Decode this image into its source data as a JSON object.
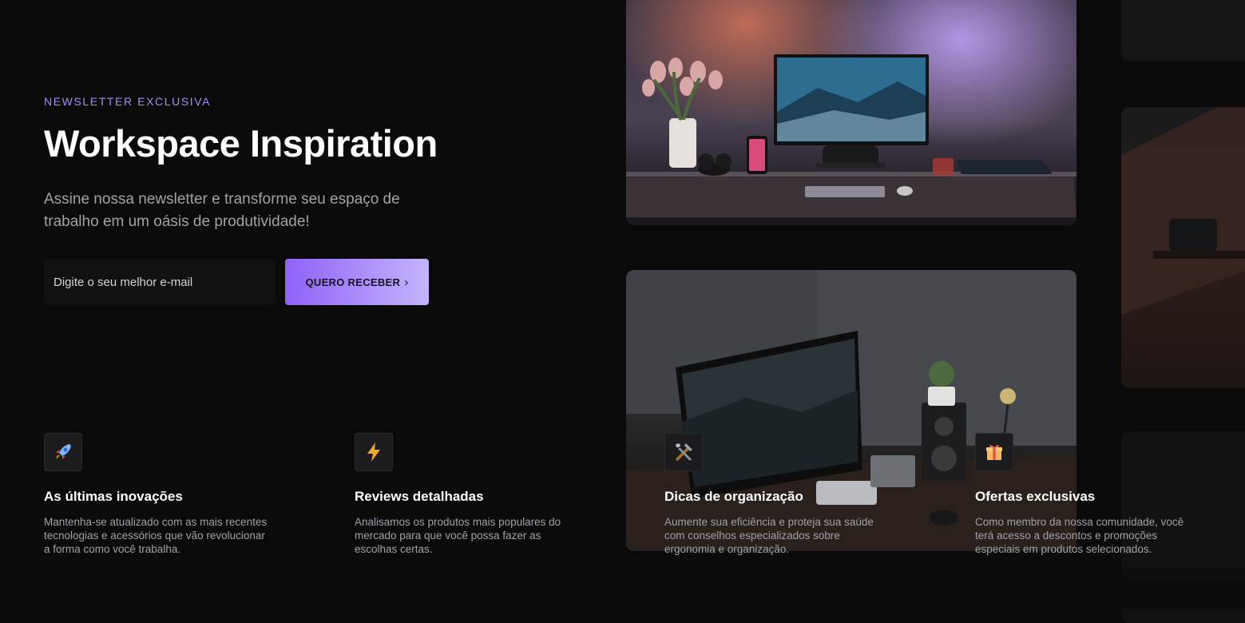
{
  "hero": {
    "eyebrow": "NEWSLETTER EXCLUSIVA",
    "title": "Workspace Inspiration",
    "subtitle": "Assine nossa newsletter e transforme seu espaço de trabalho em um oásis de produtividade!"
  },
  "form": {
    "email_placeholder": "Digite o seu melhor e-mail",
    "email_value": "",
    "cta_label": "QUERO RECEBER",
    "cta_icon": "chevron-right-icon",
    "cta_gradient": [
      "#9061f9",
      "#c4b5fd"
    ]
  },
  "colors": {
    "background": "#0a0a0b",
    "accent": "#a78bfa",
    "muted_text": "#a1a1aa"
  },
  "features": [
    {
      "icon": "rocket-icon",
      "title": "As últimas inovações",
      "description": "Mantenha-se atualizado com as mais recentes tecnologias e acessórios que vão revolucionar a forma como você trabalha."
    },
    {
      "icon": "lightning-icon",
      "title": "Reviews detalhadas",
      "description": "Analisamos os produtos mais populares do mercado para que você possa fazer as escolhas certas."
    },
    {
      "icon": "tools-icon",
      "title": "Dicas de organização",
      "description": "Aumente sua eficiência e proteja sua saúde com conselhos especializados sobre ergonomia e organização."
    },
    {
      "icon": "gift-icon",
      "title": "Ofertas exclusivas",
      "description": "Como membro da nossa comunidade, você terá acesso a descontos e promoções especiais em produtos selecionados."
    }
  ]
}
